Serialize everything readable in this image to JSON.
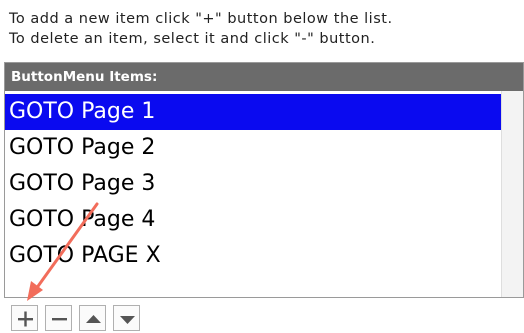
{
  "instructions": {
    "line1": "To add a new item click \"+\" button below the list.",
    "line2": "To delete an item, select it and click \"-\" button."
  },
  "panel": {
    "title": "ButtonMenu Items:",
    "items": [
      {
        "label": "GOTO Page 1",
        "selected": true
      },
      {
        "label": "GOTO Page 2",
        "selected": false
      },
      {
        "label": "GOTO Page 3",
        "selected": false
      },
      {
        "label": "GOTO Page 4",
        "selected": false
      },
      {
        "label": "GOTO PAGE X",
        "selected": false
      }
    ]
  },
  "toolbar": {
    "buttons": [
      {
        "icon": "plus-icon"
      },
      {
        "icon": "minus-icon"
      },
      {
        "icon": "triangle-up-icon"
      },
      {
        "icon": "triangle-down-icon"
      }
    ]
  },
  "colors": {
    "header_bg": "#6b6b6b",
    "selection": "#0a0af0",
    "annotation_arrow": "#f26d5b"
  }
}
